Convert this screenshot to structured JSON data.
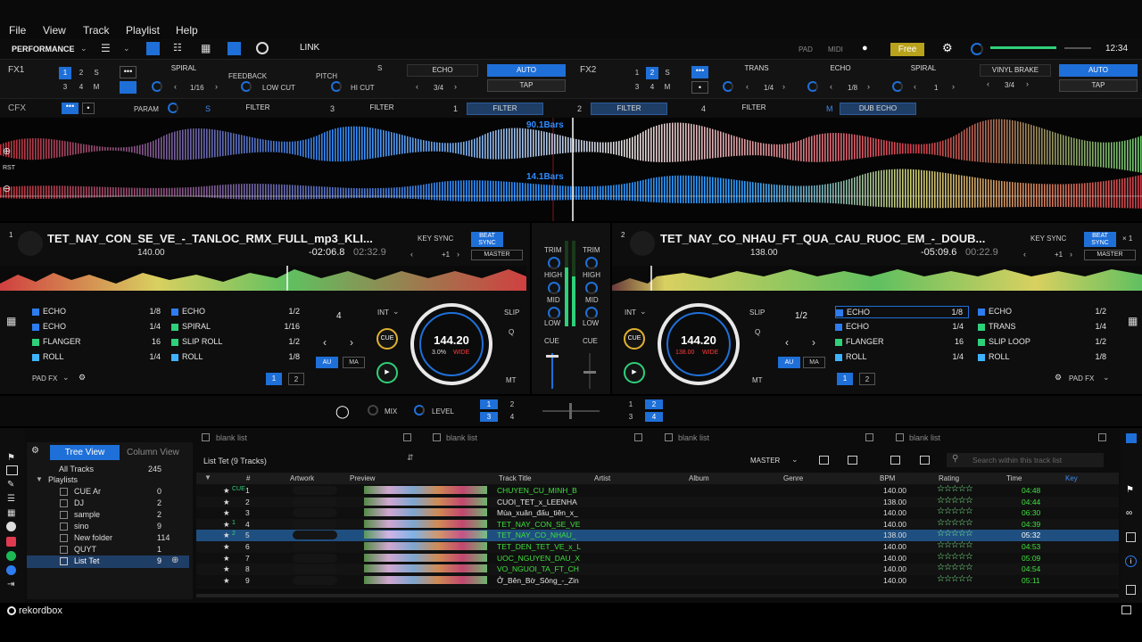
{
  "menu": [
    "File",
    "View",
    "Track",
    "Playlist",
    "Help"
  ],
  "toolbar": {
    "mode": "PERFORMANCE",
    "link": "LINK",
    "pad": "PAD",
    "midi": "MIDI",
    "plan": "Free",
    "clock": "12:34"
  },
  "fx1": {
    "label": "FX1",
    "effects": [
      "SPIRAL",
      "ECHO"
    ],
    "params": [
      "FEEDBACK",
      "PITCH"
    ],
    "beat": "1/16",
    "cut_left": "LOW CUT",
    "cut_right": "HI CUT",
    "beat2": "3/4",
    "auto": "AUTO",
    "tap": "TAP",
    "s": "S"
  },
  "fx2": {
    "label": "FX2",
    "effects": [
      "TRANS",
      "ECHO",
      "SPIRAL",
      "VINYL BRAKE"
    ],
    "beats": [
      "1/4",
      "1/8",
      "1",
      "3/4"
    ],
    "auto": "AUTO",
    "tap": "TAP"
  },
  "cfx": {
    "label": "CFX",
    "param": "PARAM",
    "slots": [
      "FILTER",
      "FILTER",
      "FILTER",
      "FILTER",
      "FILTER",
      "DUB ECHO"
    ],
    "nums": [
      "S",
      "3",
      "1",
      "2",
      "4",
      "M"
    ]
  },
  "wave": {
    "bars_top": "90.1Bars",
    "bars_bottom": "14.1Bars",
    "rst": "RST"
  },
  "deck1": {
    "num": "1",
    "title": "TET_NAY_CON_SE_VE_-_TANLOC_RMX_FULL_mp3_KLI...",
    "bpm": "140.00",
    "remain": "-02:06.8",
    "elapsed": "02:32.9",
    "key_sync": "KEY SYNC",
    "beat_sync": "BEAT SYNC",
    "plus": "+1",
    "master": "MASTER",
    "jog_bpm": "144.20",
    "jog_pitch": "3.0%",
    "jog_wide": "WIDE",
    "beat_count": "4",
    "int": "INT",
    "slip": "SLIP",
    "cue": "CUE",
    "q": "Q",
    "au": "AU",
    "ma": "MA",
    "mt": "MT",
    "padfx": "PAD FX",
    "pads_left": [
      {
        "name": "ECHO",
        "val": "1/8",
        "color": "#2d7cf0"
      },
      {
        "name": "ECHO",
        "val": "1/4",
        "color": "#2d7cf0"
      },
      {
        "name": "FLANGER",
        "val": "16",
        "color": "#2fd07a"
      },
      {
        "name": "ROLL",
        "val": "1/4",
        "color": "#3fb2ff"
      }
    ],
    "pads_right": [
      {
        "name": "ECHO",
        "val": "1/2",
        "color": "#2d7cf0"
      },
      {
        "name": "SPIRAL",
        "val": "1/16",
        "color": "#2fd07a"
      },
      {
        "name": "SLIP ROLL",
        "val": "1/2",
        "color": "#2fd07a"
      },
      {
        "name": "ROLL",
        "val": "1/8",
        "color": "#3fb2ff"
      }
    ],
    "banks": [
      "1",
      "2"
    ]
  },
  "deck2": {
    "num": "2",
    "title": "TET_NAY_CO_NHAU_FT_QUA_CAU_RUOC_EM_-_DOUB...",
    "bpm": "138.00",
    "remain": "-05:09.6",
    "elapsed": "00:22.9",
    "key_sync": "KEY SYNC",
    "beat_sync": "BEAT SYNC",
    "plus": "+1",
    "master": "MASTER",
    "jog_bpm": "144.20",
    "jog_pitch": "138.00",
    "jog_wide": "WIDE",
    "beat_count": "1/2",
    "int": "INT",
    "slip": "SLIP",
    "cue": "CUE",
    "q": "Q",
    "au": "AU",
    "ma": "MA",
    "mt": "MT",
    "padfx": "PAD FX",
    "x1": "× 1",
    "pads_left": [
      {
        "name": "ECHO",
        "val": "1/8",
        "color": "#2d7cf0"
      },
      {
        "name": "ECHO",
        "val": "1/4",
        "color": "#2d7cf0"
      },
      {
        "name": "FLANGER",
        "val": "16",
        "color": "#2fd07a"
      },
      {
        "name": "ROLL",
        "val": "1/4",
        "color": "#3fb2ff"
      }
    ],
    "pads_right": [
      {
        "name": "ECHO",
        "val": "1/2",
        "color": "#2d7cf0"
      },
      {
        "name": "TRANS",
        "val": "1/4",
        "color": "#2fd07a"
      },
      {
        "name": "SLIP LOOP",
        "val": "1/2",
        "color": "#2fd07a"
      },
      {
        "name": "ROLL",
        "val": "1/8",
        "color": "#3fb2ff"
      }
    ],
    "banks": [
      "1",
      "2"
    ]
  },
  "mixer": {
    "eq": [
      "TRIM",
      "HIGH",
      "MID",
      "LOW"
    ],
    "cue": "CUE",
    "mix": "MIX",
    "level": "LEVEL",
    "deck_sel_left": [
      "1",
      "2",
      "3",
      "4"
    ],
    "deck_sel_right": [
      "1",
      "2",
      "3",
      "4"
    ]
  },
  "browser": {
    "tree_view": "Tree View",
    "column_view": "Column View",
    "all_tracks": "All Tracks",
    "all_count": "245",
    "playlists": "Playlists",
    "playlist_items": [
      {
        "name": "CUE Ar",
        "count": "0"
      },
      {
        "name": "DJ",
        "count": "2"
      },
      {
        "name": "sample",
        "count": "2"
      },
      {
        "name": "sino",
        "count": "9"
      },
      {
        "name": "New folder",
        "count": "114"
      },
      {
        "name": "QUYT",
        "count": "1"
      },
      {
        "name": "List Tet",
        "count": "9"
      }
    ],
    "blank_tabs": [
      "blank list",
      "blank list",
      "blank list",
      "blank list"
    ],
    "list_title": "List Tet (9 Tracks)",
    "master": "MASTER",
    "search_placeholder": "Search within this track list",
    "columns": [
      "#",
      "Artwork",
      "Preview",
      "Track Title",
      "Artist",
      "Album",
      "Genre",
      "BPM",
      "Rating",
      "Time",
      "Key"
    ],
    "tracks": [
      {
        "n": "1",
        "title": "CHUYEN_CU_MINH_B",
        "bpm": "140.00",
        "time": "04:48",
        "color": "#3fe03f",
        "mark": "CUE"
      },
      {
        "n": "2",
        "title": "CUOI_TET_x_LEENHA",
        "bpm": "138.00",
        "time": "04:44",
        "color": "#e6e6e6",
        "mark": ""
      },
      {
        "n": "3",
        "title": "Mùa_xuân_đấu_tiên_x_",
        "bpm": "140.00",
        "time": "06:30",
        "color": "#e6e6e6",
        "mark": ""
      },
      {
        "n": "4",
        "title": "TET_NAY_CON_SE_VE",
        "bpm": "140.00",
        "time": "04:39",
        "color": "#3fe03f",
        "mark": "1"
      },
      {
        "n": "5",
        "title": "TET_NAY_CO_NHAU_",
        "bpm": "138.00",
        "time": "05:32",
        "color": "#3fe03f",
        "mark": "2"
      },
      {
        "n": "6",
        "title": "TET_DEN_TET_VE_x_L",
        "bpm": "140.00",
        "time": "04:53",
        "color": "#3fe03f",
        "mark": ""
      },
      {
        "n": "7",
        "title": "UOC_NGUYEN_DAU_X",
        "bpm": "140.00",
        "time": "05:09",
        "color": "#3fe03f",
        "mark": ""
      },
      {
        "n": "8",
        "title": "VO_NGUOI_TA_FT_CH",
        "bpm": "140.00",
        "time": "04:54",
        "color": "#3fe03f",
        "mark": ""
      },
      {
        "n": "9",
        "title": "Ở_Bên_Bờ_Sông_-_Zin",
        "bpm": "140.00",
        "time": "05:11",
        "color": "#e6e6e6",
        "mark": ""
      }
    ]
  },
  "footer": {
    "brand": "rekordbox"
  }
}
